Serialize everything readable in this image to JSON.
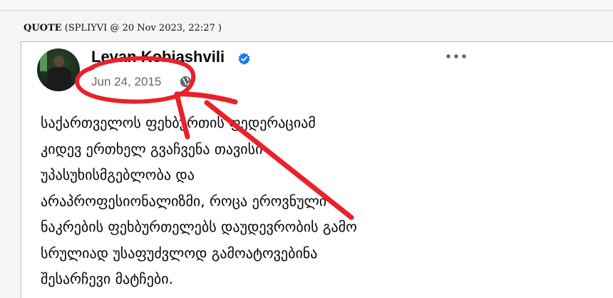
{
  "quote": {
    "label": "QUOTE",
    "meta": " (SPLIYVI @ 20 Nov 2023, 22:27 )"
  },
  "post": {
    "author": "Levan Kobiashvili",
    "date": "Jun 24, 2015",
    "lines": [
      "საქართველოს ფეხბურთის ფედერაციამ",
      "კიდევ ერთხელ გვაჩვენა თავისი",
      "უპასუხისმგებლობა და",
      "არაპროფესიონალიზმი, როცა ეროვნული",
      "ნაკრების ფეხბურთელებს დაუდევრობის გამო",
      "სრულიად უსაფუძვლოდ გამოატოვებინა",
      "შესარჩევი მატჩები."
    ]
  },
  "icons": {
    "verified": "verified-badge-icon",
    "audience": "globe-icon",
    "more": "more-options-icon"
  },
  "colors": {
    "verified_blue": "#1877f2",
    "annotation_red": "#e8212b",
    "meta_gray": "#65676b"
  }
}
